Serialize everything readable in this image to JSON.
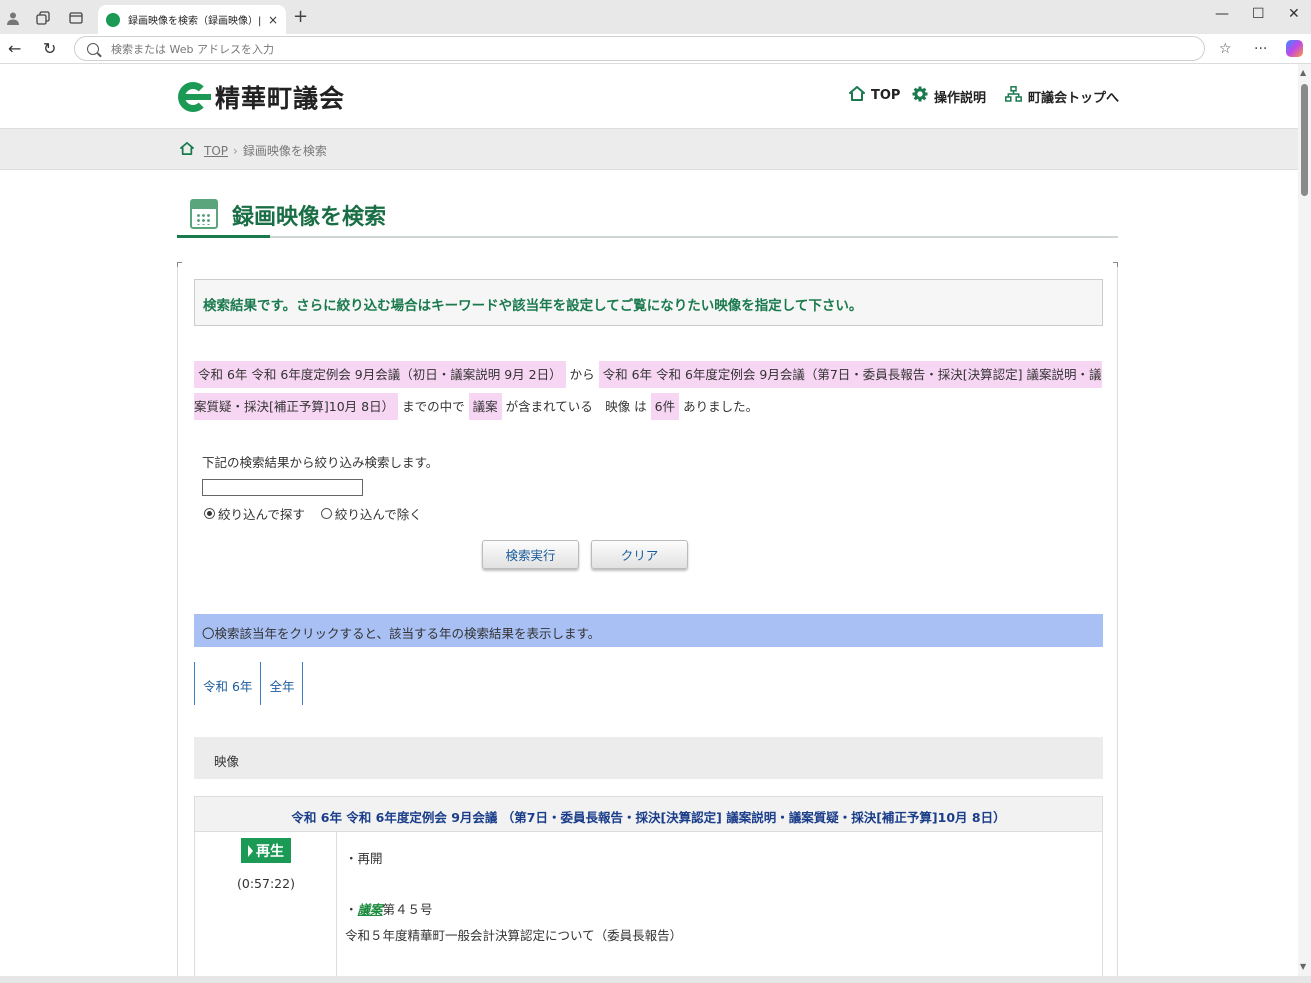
{
  "browser": {
    "tab_title": "録画映像を検索（録画映像）| 精華町議会",
    "tab_close": "×",
    "new_tab": "+",
    "address_placeholder": "検索または Web アドレスを入力",
    "icons": [
      "profile-icon",
      "collections-icon",
      "tab-actions-icon",
      "back-icon",
      "refresh-icon",
      "favorites-icon",
      "more-icon",
      "copilot-icon"
    ]
  },
  "header": {
    "site_name": "精華町議会",
    "nav": [
      {
        "label": "TOP",
        "icon": "home-icon"
      },
      {
        "label": "操作説明",
        "icon": "gear-icon"
      },
      {
        "label": "町議会トップへ",
        "icon": "sitemap-icon"
      }
    ]
  },
  "breadcrumb": {
    "items": [
      "TOP",
      "録画映像を検索"
    ]
  },
  "page": {
    "title": "録画映像を検索",
    "notice": "検索結果です。さらに絞り込む場合はキーワードや該当年を設定してご覧になりたい映像を指定して下さい。"
  },
  "summary": {
    "from": "令和 6年 令和 6年度定例会 9月会議（初日・議案説明 9月 2日）",
    "from_suffix": "から",
    "to": "令和 6年 令和 6年度定例会 9月会議（第7日・委員長報告・採決[決算認定] 議案説明・議案質疑・採決[補正予算]10月 8日）",
    "to_suffix": "までの中で",
    "keyword": "議案",
    "keyword_suffix": "が含まれている　映像 は",
    "count": "6件",
    "count_suffix": "ありました。"
  },
  "refine": {
    "label": "下記の検索結果から絞り込み検索します。",
    "input_value": "",
    "options": [
      "絞り込んで探す",
      "絞り込んで除く"
    ],
    "selected": "絞り込んで探す",
    "search_button": "検索実行",
    "clear_button": "クリア"
  },
  "year_filter": {
    "info": "〇検索該当年をクリックすると、該当する年の検索結果を表示します。",
    "tabs": [
      "令和 6年",
      "全年"
    ]
  },
  "results": {
    "header": "映像",
    "items": [
      {
        "title": "令和 6年 令和 6年度定例会 9月会議 （第7日・委員長報告・採決[決算認定] 議案説明・議案質疑・採決[補正予算]10月 8日）",
        "play_label": "再生",
        "duration": "(0:57:22)",
        "line1": "・再開",
        "bullet": "・",
        "keyword": "議案",
        "line2_rest": "第４５号",
        "line3": "令和５年度精華町一般会計決算認定について（委員長報告）"
      }
    ]
  },
  "colors": {
    "brand_green": "#1a9a55",
    "title_green": "#1a6e45",
    "highlight_pink": "#f7d6f4",
    "info_blue": "#a8c0f4",
    "link_blue": "#1a5c9a"
  }
}
